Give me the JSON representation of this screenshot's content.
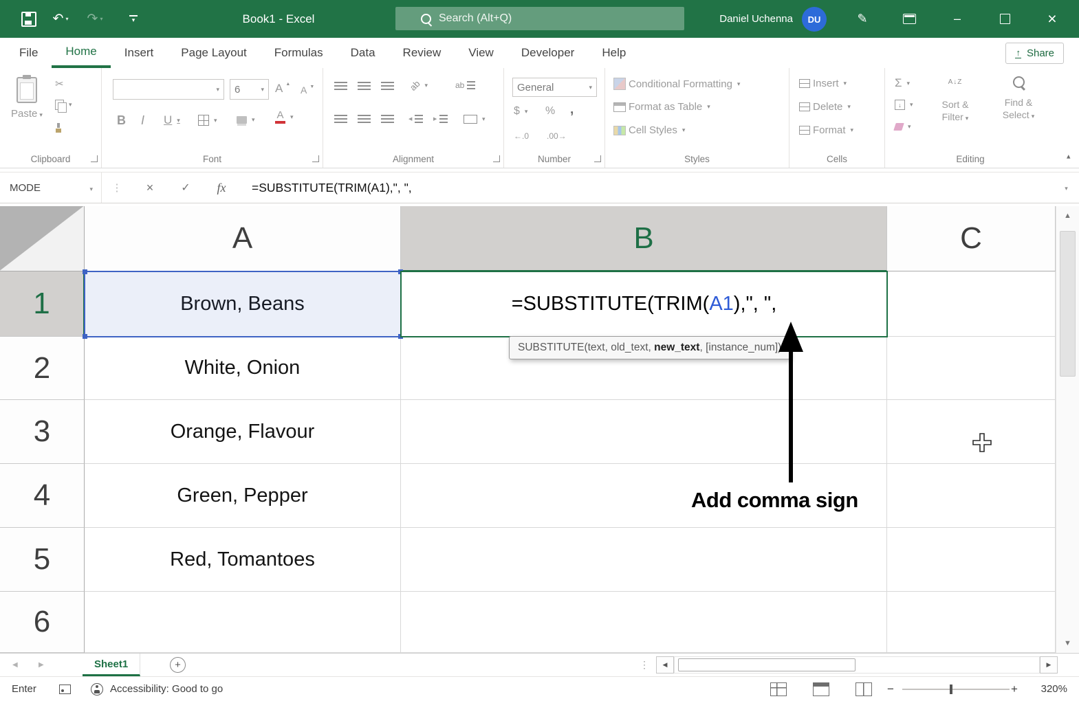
{
  "titlebar": {
    "title": "Book1 - Excel",
    "search_placeholder": "Search (Alt+Q)",
    "user_name": "Daniel Uchenna",
    "user_initials": "DU"
  },
  "ribbon_tabs": [
    "File",
    "Home",
    "Insert",
    "Page Layout",
    "Formulas",
    "Data",
    "Review",
    "View",
    "Developer",
    "Help"
  ],
  "share_label": "Share",
  "ribbon": {
    "groups": {
      "clipboard": "Clipboard",
      "font": "Font",
      "alignment": "Alignment",
      "number": "Number",
      "styles": "Styles",
      "cells": "Cells",
      "editing": "Editing"
    },
    "paste_label": "Paste",
    "font_size": "6",
    "number_format": "General",
    "conditional_formatting": "Conditional Formatting",
    "format_as_table": "Format as Table",
    "cell_styles": "Cell Styles",
    "insert_label": "Insert",
    "delete_label": "Delete",
    "format_label": "Format",
    "sort_filter_line1": "Sort &",
    "sort_filter_line2": "Filter",
    "find_select_line1": "Find &",
    "find_select_line2": "Select",
    "inc_decimal": "←.0",
    "dec_decimal": ".00→"
  },
  "formula_bar": {
    "name_box": "MODE",
    "fx": "fx",
    "formula": "=SUBSTITUTE(TRIM(A1),\", \","
  },
  "grid": {
    "columns": [
      "A",
      "B",
      "C"
    ],
    "row_numbers": [
      "1",
      "2",
      "3",
      "4",
      "5",
      "6"
    ],
    "a_values": [
      "Brown, Beans",
      "White, Onion",
      "Orange, Flavour",
      "Green, Pepper",
      "Red, Tomantoes"
    ],
    "b1": {
      "pre": "=SUBSTITUTE(TRIM(",
      "ref": "A1",
      "post": "),\", \","
    }
  },
  "tooltip": {
    "pre": "SUBSTITUTE(text, old_text, ",
    "active_arg": "new_text",
    "post": ", [instance_num])"
  },
  "annotation": {
    "label": "Add comma sign"
  },
  "sheet_bar": {
    "active_tab": "Sheet1"
  },
  "status_bar": {
    "mode": "Enter",
    "accessibility": "Accessibility: Good to go",
    "zoom": "320%"
  },
  "glyphs": {
    "close": "×",
    "minimize": "–",
    "undo": "↶",
    "redo": "↷",
    "pen": "✎",
    "cut": "✂",
    "letter_a": "A",
    "bold": "B",
    "italic": "I",
    "underline": "U",
    "dollar": "$",
    "percent": "%",
    "comma": ",",
    "autosum": "Σ",
    "ab": "ab",
    "cancel": "×",
    "enter": "✓",
    "dots": "⋮",
    "plus": "+",
    "minus": "−",
    "left": "◀",
    "right": "▶",
    "up": "▲",
    "down": "▼",
    "down_arrow": "↓",
    "sort": "A↓Z",
    "share": "↑"
  },
  "colors": {
    "title_green": "#217346",
    "selection_green": "#1E7145",
    "reference_blue": "#2E5BD7",
    "header_selected_gray": "#D2D0CE",
    "avatar_blue": "#2D6BD9",
    "font_color_red": "#D13438"
  }
}
